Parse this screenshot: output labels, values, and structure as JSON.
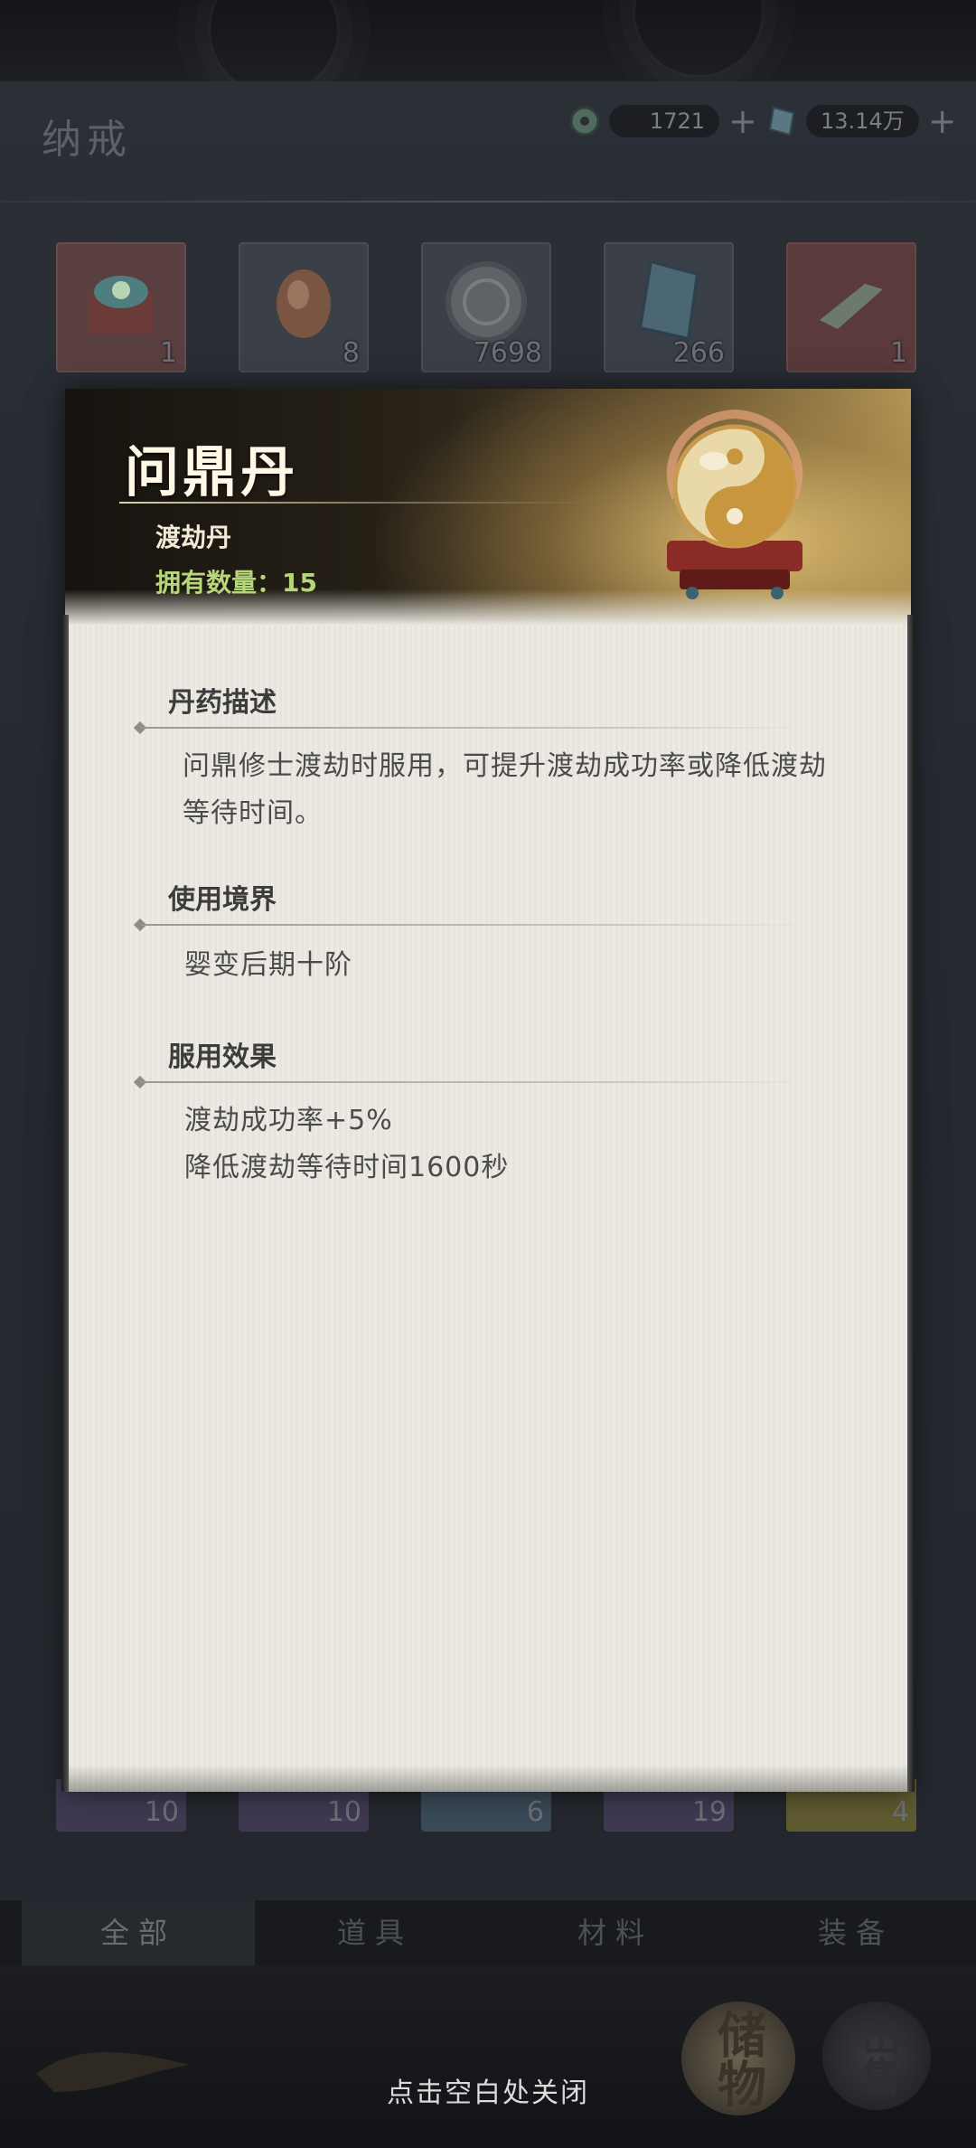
{
  "header": {
    "title": "纳戒",
    "currency1": {
      "icon": "jade-coin-icon",
      "value": "1721"
    },
    "currency2": {
      "icon": "spirit-stone-icon",
      "value": "13.14万"
    }
  },
  "inventory": {
    "top_row": [
      {
        "name": "treasure-chest",
        "count": "1"
      },
      {
        "name": "spirit-egg",
        "count": "8"
      },
      {
        "name": "silver-token",
        "count": "7698"
      },
      {
        "name": "spirit-stone",
        "count": "266"
      },
      {
        "name": "jade-pendant",
        "count": "1"
      }
    ],
    "bottom_row": [
      {
        "name": "item-a",
        "count": "10"
      },
      {
        "name": "item-b",
        "count": "10"
      },
      {
        "name": "item-c",
        "count": "6"
      },
      {
        "name": "item-d",
        "count": "19"
      },
      {
        "name": "item-e",
        "count": "4"
      }
    ]
  },
  "tabs": [
    "全部",
    "道具",
    "材料",
    "装备"
  ],
  "active_tab": "全部",
  "modal": {
    "item_name": "问鼎丹",
    "item_type": "渡劫丹",
    "owned_label": "拥有数量：15",
    "icon": "yin-yang-pill-icon",
    "sections": [
      {
        "title": "丹药描述",
        "text": "问鼎修士渡劫时服用，可提升渡劫成功率或降低渡劫等待时间。"
      },
      {
        "title": "使用境界",
        "text": "婴变后期十阶"
      },
      {
        "title": "服用效果",
        "lines": [
          "渡劫成功率+5%",
          "降低渡劫等待时间1600秒"
        ]
      }
    ]
  },
  "footer": {
    "close_hint": "点击空白处关闭",
    "storage_button": "储物",
    "sell_button": "出售"
  }
}
